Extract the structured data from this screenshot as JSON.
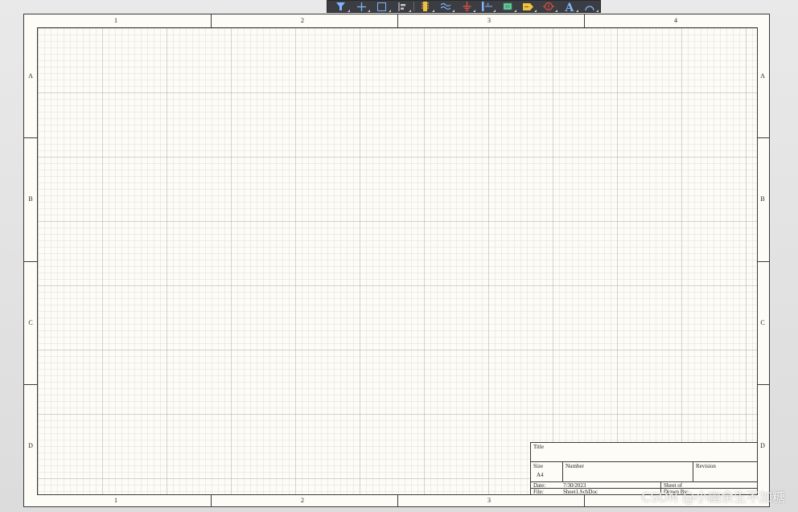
{
  "sheet": {
    "columns": [
      "1",
      "2",
      "3",
      "4"
    ],
    "rows": [
      "A",
      "B",
      "C",
      "D"
    ]
  },
  "title_block": {
    "title_label": "Title",
    "size_label": "Size",
    "size_value": "A4",
    "number_label": "Number",
    "revision_label": "Revision",
    "date_label": "Date:",
    "date_value": "7/30/2023",
    "file_label": "File:",
    "file_value": "Sheet1.SchDoc",
    "sheet_label": "Sheet   of",
    "drawn_by_label": "Drawn By:"
  },
  "toolbar": {
    "tools": [
      {
        "name": "filter-tool",
        "icon": "filter-icon",
        "color": "#7fb7ff"
      },
      {
        "name": "move-tool",
        "icon": "crosshair-icon",
        "color": "#7fb7ff"
      },
      {
        "name": "select-tool",
        "icon": "select-rect-icon",
        "color": "#7fb7ff"
      },
      {
        "name": "align-tool",
        "icon": "align-icon",
        "color": "#c8c8c8"
      },
      {
        "name": "place-part-tool",
        "icon": "component-icon",
        "color": "#f0c040"
      },
      {
        "name": "wire-tool",
        "icon": "wire-icon",
        "color": "#7fb7ff"
      },
      {
        "name": "gnd-power-tool",
        "icon": "ground-icon",
        "color": "#e05040"
      },
      {
        "name": "bus-tool",
        "icon": "bus-icon",
        "color": "#7fb7ff"
      },
      {
        "name": "sheet-symbol-tool",
        "icon": "sheet-symbol-icon",
        "color": "#6fd0a0"
      },
      {
        "name": "port-tool",
        "icon": "port-icon",
        "color": "#f0c040"
      },
      {
        "name": "no-erc-tool",
        "icon": "directive-icon",
        "color": "#e05040"
      },
      {
        "name": "text-tool",
        "icon": "text-icon",
        "color": "#7fb7ff"
      },
      {
        "name": "arc-tool",
        "icon": "arc-icon",
        "color": "#7fb7ff"
      }
    ]
  },
  "watermark": "CSDN @小幽余生不加糖"
}
